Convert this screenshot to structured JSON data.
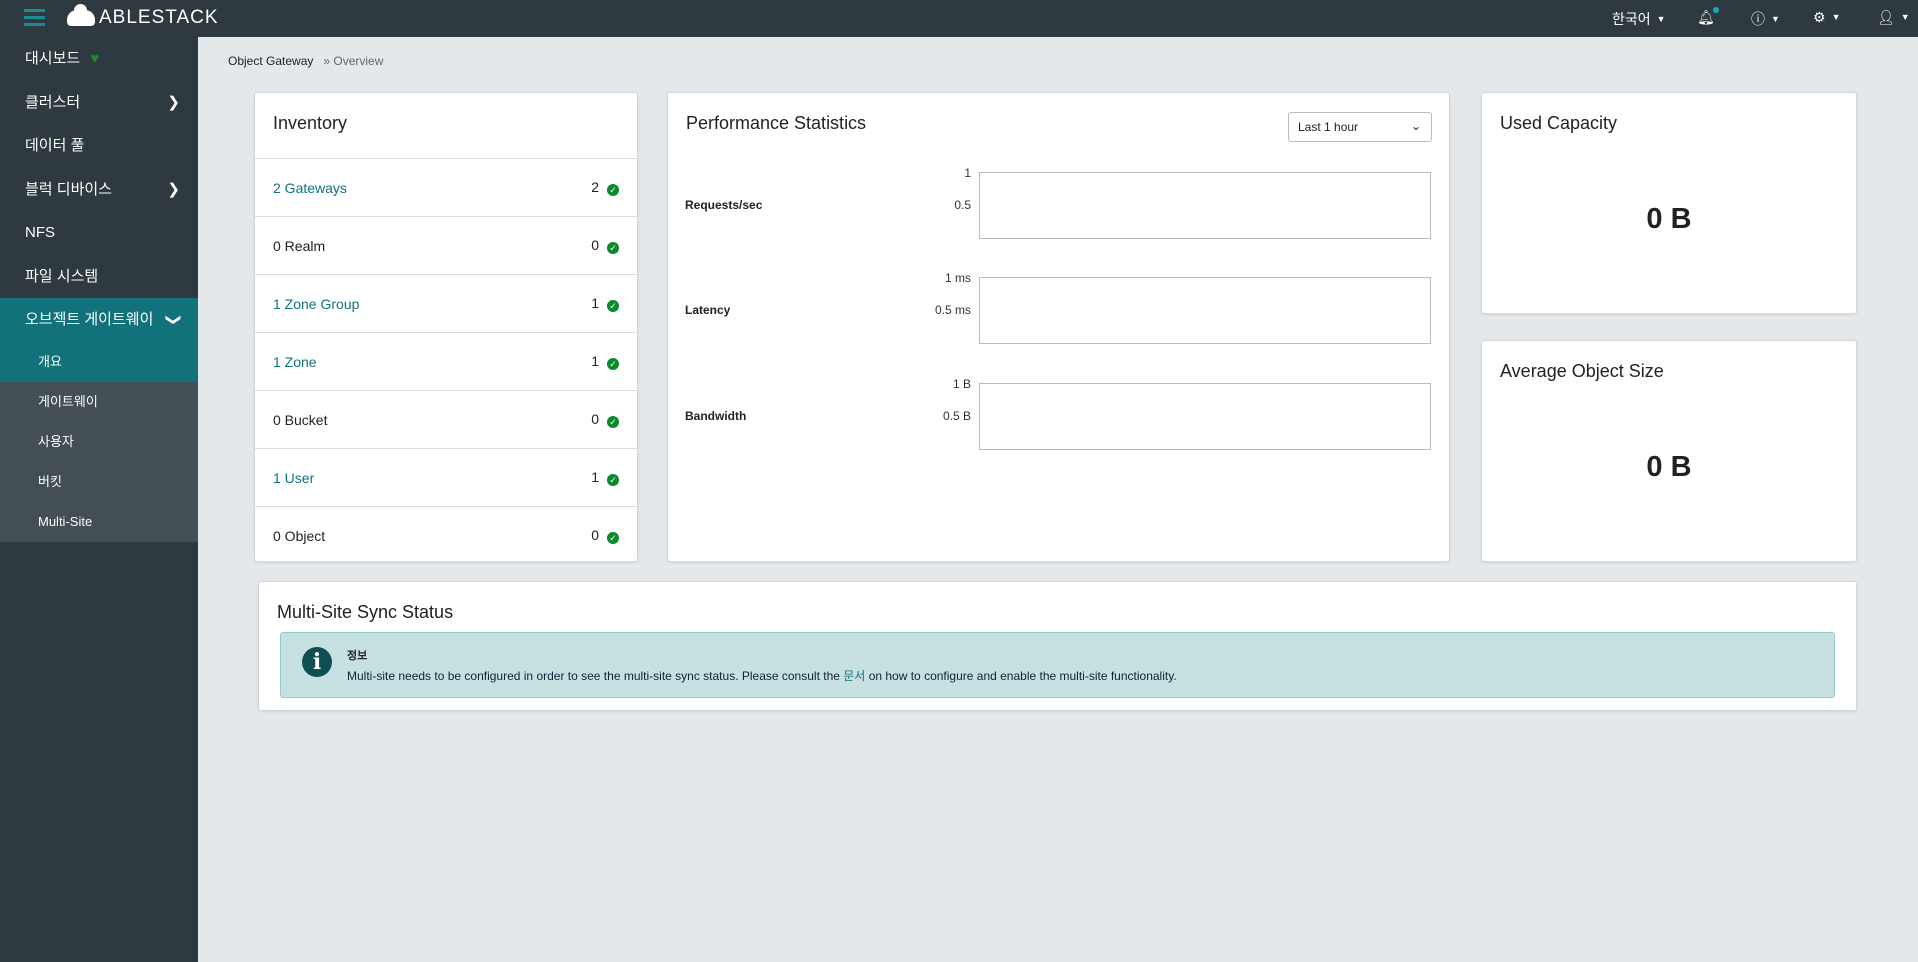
{
  "brand": "ABLESTACK",
  "topbar": {
    "language": "한국어"
  },
  "sidebar": {
    "items": [
      {
        "label": "대시보드"
      },
      {
        "label": "클러스터"
      },
      {
        "label": "데이터 풀"
      },
      {
        "label": "블럭 디바이스"
      },
      {
        "label": "NFS"
      },
      {
        "label": "파일 시스템"
      },
      {
        "label": "오브젝트 게이트웨이"
      }
    ],
    "sub": [
      {
        "label": "개요"
      },
      {
        "label": "게이트웨이"
      },
      {
        "label": "사용자"
      },
      {
        "label": "버킷"
      },
      {
        "label": "Multi-Site"
      }
    ]
  },
  "breadcrumb": {
    "parent": "Object Gateway",
    "current": "Overview"
  },
  "inventory": {
    "title": "Inventory",
    "rows": [
      {
        "label": "2 Gateways",
        "count": "2",
        "link": true
      },
      {
        "label": "0 Realm",
        "count": "0",
        "link": false
      },
      {
        "label": "1 Zone Group",
        "count": "1",
        "link": true
      },
      {
        "label": "1 Zone",
        "count": "1",
        "link": true
      },
      {
        "label": "0 Bucket",
        "count": "0",
        "link": false
      },
      {
        "label": "1 User",
        "count": "1",
        "link": true
      },
      {
        "label": "0 Object",
        "count": "0",
        "link": false
      }
    ]
  },
  "performance": {
    "title": "Performance Statistics",
    "range": "Last 1 hour",
    "charts": [
      {
        "label": "Requests/sec",
        "ticks": [
          "1",
          "0.5"
        ]
      },
      {
        "label": "Latency",
        "ticks": [
          "1 ms",
          "0.5 ms"
        ]
      },
      {
        "label": "Bandwidth",
        "ticks": [
          "1 B",
          "0.5 B"
        ]
      }
    ]
  },
  "used_capacity": {
    "title": "Used Capacity",
    "value": "0 B"
  },
  "avg_object": {
    "title": "Average Object Size",
    "value": "0 B"
  },
  "multisite": {
    "title": "Multi-Site Sync Status",
    "alert_title": "정보",
    "msg_before": "Multi-site needs to be configured in order to see the multi-site sync status. Please consult the ",
    "link": "문서",
    "msg_after": " on how to configure and enable the multi-site functionality."
  }
}
